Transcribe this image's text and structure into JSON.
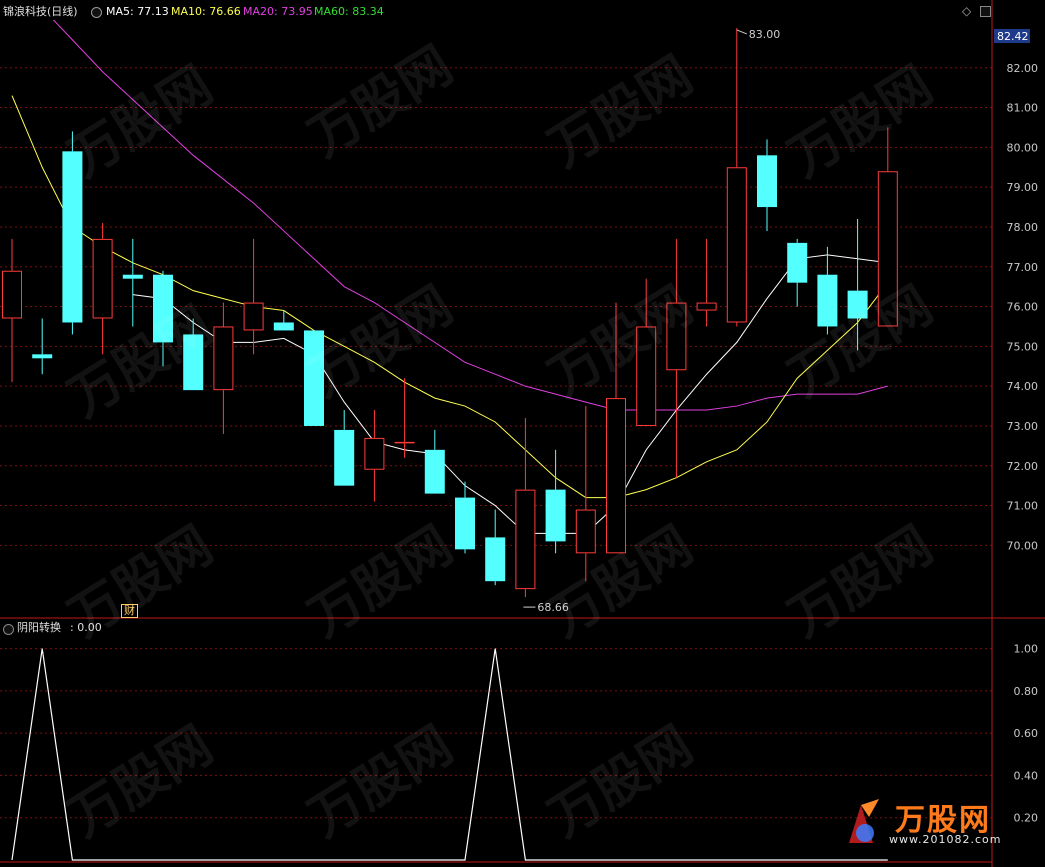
{
  "header": {
    "stock_title": "锦浪科技(日线)",
    "ma5": "MA5: 77.13",
    "ma10": "MA10: 76.66",
    "ma20": "MA20: 73.95",
    "ma60": "MA60: 83.34"
  },
  "indicator": {
    "title": "阴阳转换",
    "value_text": ": 0.00"
  },
  "finance_badge": "财",
  "current_price_tag": "82.42",
  "watermark_text": "万股网",
  "logo": {
    "brand": "万股网",
    "url": "www.201082.com"
  },
  "colors": {
    "up": "#ff3b3b",
    "down": "#54ffff",
    "ma5": "#ffffff",
    "ma10": "#ffff4d",
    "ma20": "#e040e0",
    "ma60": "#33dd33",
    "grid": "#7a1010",
    "axis": "#c01818"
  },
  "chart_data": {
    "type": "candlestick",
    "price_axis": {
      "ylim": [
        68.2,
        83.2
      ],
      "ticks": [
        "82.00",
        "81.00",
        "80.00",
        "79.00",
        "78.00",
        "77.00",
        "76.00",
        "75.00",
        "74.00",
        "73.00",
        "72.00",
        "71.00",
        "70.00"
      ]
    },
    "max_label": "83.00",
    "min_label": "68.66",
    "candles": [
      {
        "o": 75.7,
        "h": 77.7,
        "l": 74.1,
        "c": 76.9
      },
      {
        "o": 74.8,
        "h": 75.7,
        "l": 74.3,
        "c": 74.7
      },
      {
        "o": 79.9,
        "h": 80.4,
        "l": 75.3,
        "c": 75.6
      },
      {
        "o": 75.7,
        "h": 78.1,
        "l": 74.8,
        "c": 77.7
      },
      {
        "o": 76.8,
        "h": 77.7,
        "l": 75.5,
        "c": 76.7
      },
      {
        "o": 76.8,
        "h": 76.9,
        "l": 74.5,
        "c": 75.1
      },
      {
        "o": 75.3,
        "h": 75.7,
        "l": 73.9,
        "c": 73.9
      },
      {
        "o": 73.9,
        "h": 76.1,
        "l": 72.8,
        "c": 75.5
      },
      {
        "o": 75.4,
        "h": 77.7,
        "l": 74.8,
        "c": 76.1
      },
      {
        "o": 75.6,
        "h": 75.9,
        "l": 75.4,
        "c": 75.4
      },
      {
        "o": 75.4,
        "h": 75.4,
        "l": 73.0,
        "c": 73.0
      },
      {
        "o": 72.9,
        "h": 73.4,
        "l": 71.5,
        "c": 71.5
      },
      {
        "o": 71.9,
        "h": 73.4,
        "l": 71.1,
        "c": 72.7
      },
      {
        "o": 72.6,
        "h": 74.2,
        "l": 72.2,
        "c": 72.6
      },
      {
        "o": 72.4,
        "h": 72.9,
        "l": 71.3,
        "c": 71.3
      },
      {
        "o": 71.2,
        "h": 71.6,
        "l": 69.8,
        "c": 69.9
      },
      {
        "o": 70.2,
        "h": 70.9,
        "l": 69.0,
        "c": 69.1
      },
      {
        "o": 68.9,
        "h": 73.2,
        "l": 68.7,
        "c": 71.4
      },
      {
        "o": 71.4,
        "h": 72.4,
        "l": 69.8,
        "c": 70.1
      },
      {
        "o": 69.8,
        "h": 73.5,
        "l": 69.1,
        "c": 70.9
      },
      {
        "o": 69.8,
        "h": 76.1,
        "l": 69.8,
        "c": 73.7
      },
      {
        "o": 73.0,
        "h": 76.7,
        "l": 73.1,
        "c": 75.5
      },
      {
        "o": 74.4,
        "h": 77.7,
        "l": 71.7,
        "c": 76.1
      },
      {
        "o": 75.9,
        "h": 77.7,
        "l": 75.5,
        "c": 76.1
      },
      {
        "o": 75.6,
        "h": 83.0,
        "l": 75.5,
        "c": 79.5
      },
      {
        "o": 79.8,
        "h": 80.2,
        "l": 77.9,
        "c": 78.5
      },
      {
        "o": 77.6,
        "h": 77.7,
        "l": 76.0,
        "c": 76.6
      },
      {
        "o": 76.8,
        "h": 77.5,
        "l": 75.3,
        "c": 75.5
      },
      {
        "o": 76.4,
        "h": 78.2,
        "l": 74.9,
        "c": 75.7
      },
      {
        "o": 75.5,
        "h": 80.5,
        "l": 75.5,
        "c": 79.4
      }
    ],
    "ma5": [
      null,
      null,
      null,
      null,
      76.3,
      76.2,
      75.6,
      75.1,
      75.1,
      75.2,
      74.8,
      73.6,
      72.6,
      72.4,
      72.3,
      71.5,
      71.0,
      70.3,
      70.3,
      70.3,
      71.0,
      72.4,
      73.4,
      74.3,
      75.1,
      76.2,
      77.2,
      77.3,
      77.2,
      77.1
    ],
    "ma10": [
      81.3,
      79.5,
      78.0,
      77.5,
      77.1,
      76.8,
      76.4,
      76.2,
      76.0,
      75.9,
      75.4,
      75.0,
      74.6,
      74.1,
      73.7,
      73.5,
      73.1,
      72.4,
      71.7,
      71.2,
      71.2,
      71.4,
      71.7,
      72.1,
      72.4,
      73.1,
      74.2,
      74.9,
      75.6,
      76.6
    ],
    "ma20": [
      84.2,
      83.5,
      82.7,
      81.9,
      81.2,
      80.5,
      79.8,
      79.2,
      78.6,
      77.9,
      77.2,
      76.5,
      76.1,
      75.6,
      75.1,
      74.6,
      74.3,
      74.0,
      73.8,
      73.6,
      73.4,
      73.4,
      73.4,
      73.4,
      73.5,
      73.7,
      73.8,
      73.8,
      73.8,
      74.0
    ],
    "indicator_panel": {
      "type": "line",
      "name": "阴阳转换",
      "ylim": [
        0,
        1.05
      ],
      "ticks": [
        "1.00",
        "0.80",
        "0.60",
        "0.40",
        "0.20"
      ],
      "values": [
        0,
        1,
        0,
        0,
        0,
        0,
        0,
        0,
        0,
        0,
        0,
        0,
        0,
        0,
        0,
        0,
        1,
        0,
        0,
        0,
        0,
        0,
        0,
        0,
        0,
        0,
        0,
        0,
        0,
        0
      ]
    }
  }
}
